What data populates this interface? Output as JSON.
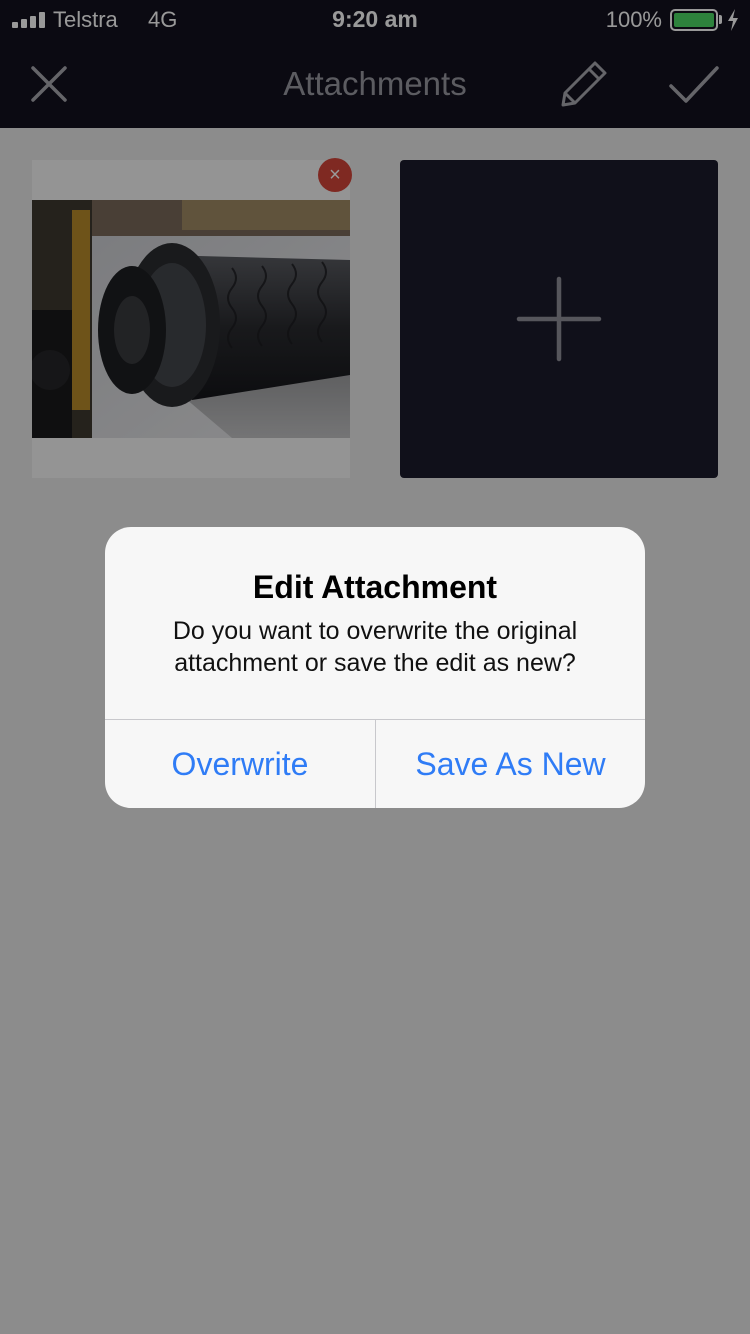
{
  "status_bar": {
    "carrier": "Telstra",
    "network": "4G",
    "time": "9:20 am",
    "battery_percent": "100%",
    "signal_icon": "signal-bars-icon",
    "battery_icon": "battery-icon",
    "charging_icon": "charging-bolt-icon",
    "battery_color": "#4cd964"
  },
  "nav": {
    "title": "Attachments",
    "close_icon": "close-icon",
    "edit_icon": "pencil-icon",
    "done_icon": "checkmark-icon",
    "background": "#13121f"
  },
  "attachments": {
    "remove_glyph": "×",
    "remove_icon": "remove-badge-icon",
    "add_icon": "plus-icon"
  },
  "dialog": {
    "title": "Edit Attachment",
    "message": "Do you want to overwrite the original attachment or save the edit as new?",
    "overwrite_label": "Overwrite",
    "save_as_new_label": "Save As New",
    "accent_color": "#2f7cf6"
  }
}
